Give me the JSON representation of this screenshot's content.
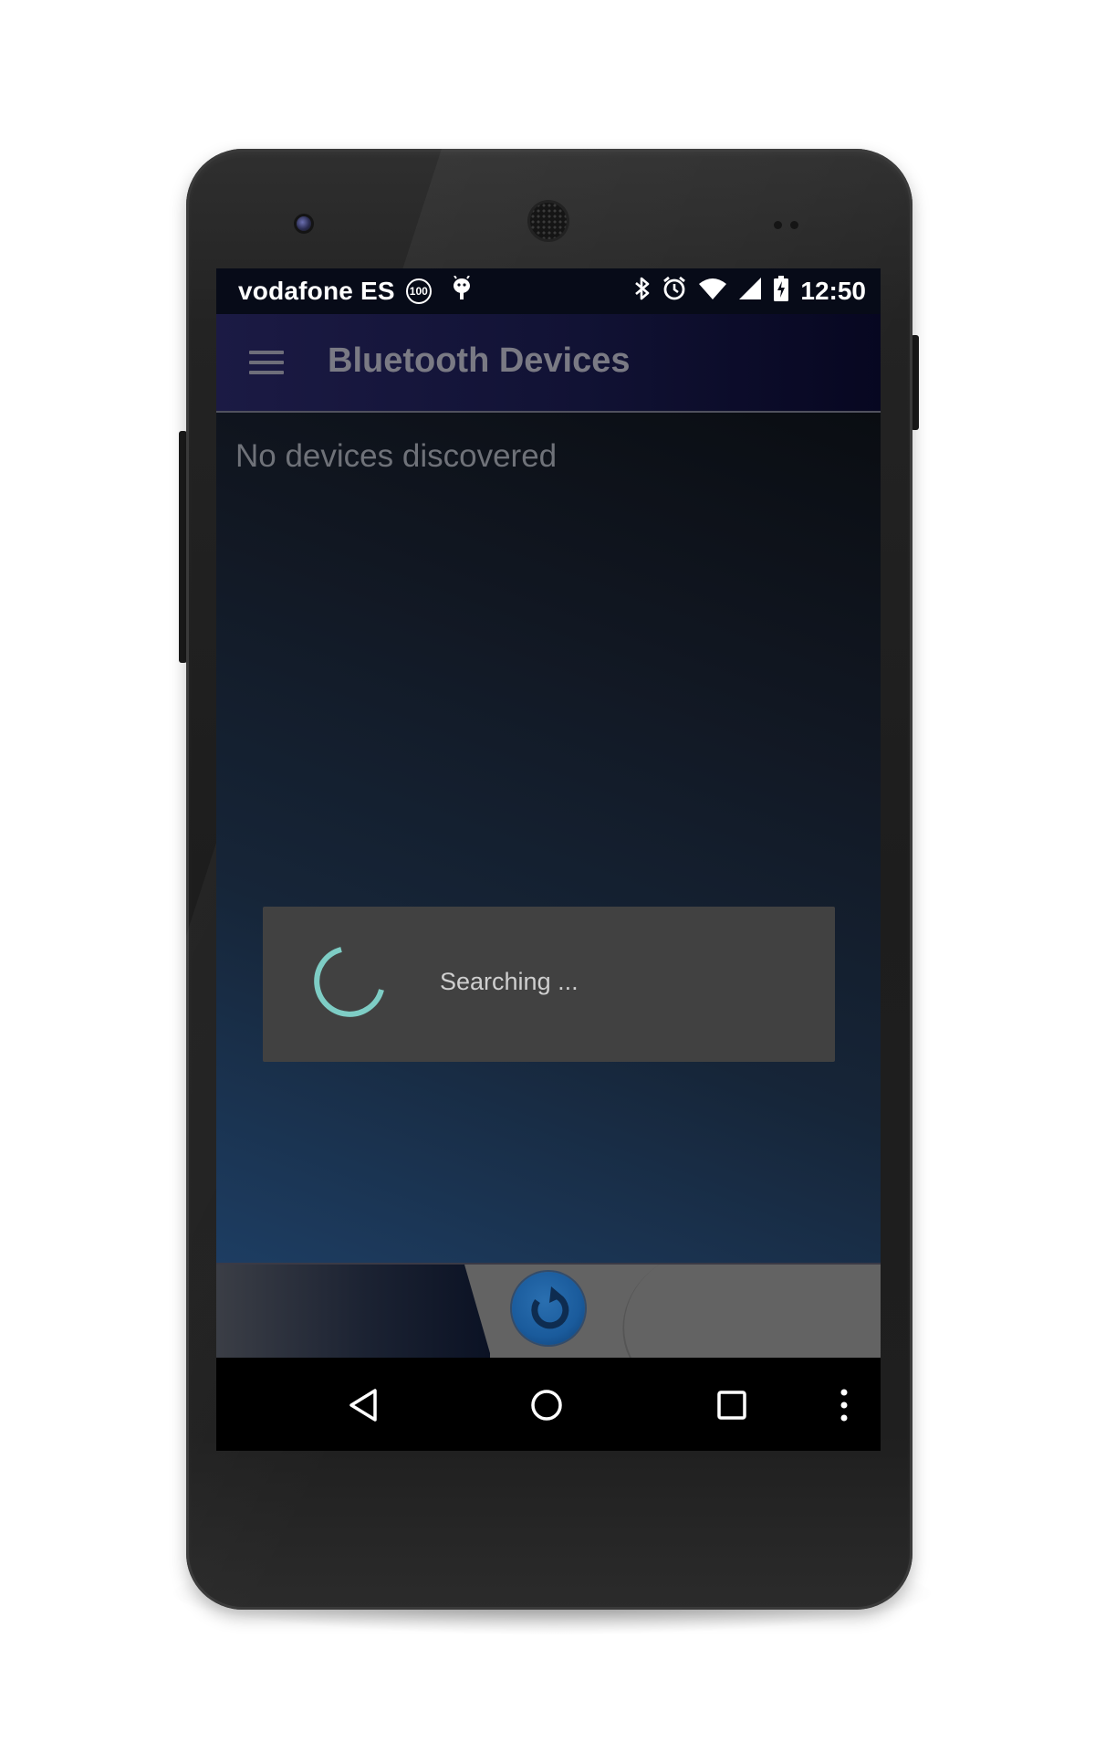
{
  "status_bar": {
    "carrier": "vodafone ES",
    "badge_value": "100",
    "time": "12:50",
    "icons": [
      "android-debug-icon",
      "bluetooth-icon",
      "alarm-icon",
      "wifi-icon",
      "signal-icon",
      "battery-charging-icon"
    ]
  },
  "app_bar": {
    "title": "Bluetooth Devices",
    "menu_icon": "hamburger-menu-icon"
  },
  "content": {
    "empty_message": "No devices discovered"
  },
  "dialog": {
    "message": "Searching ...",
    "spinner_color": "#7ecdc5"
  },
  "fab": {
    "icon": "refresh-icon",
    "color": "#1a5b9c"
  },
  "navigation_bar": {
    "buttons": [
      "back-icon",
      "home-icon",
      "recents-icon",
      "overflow-menu-icon"
    ]
  }
}
